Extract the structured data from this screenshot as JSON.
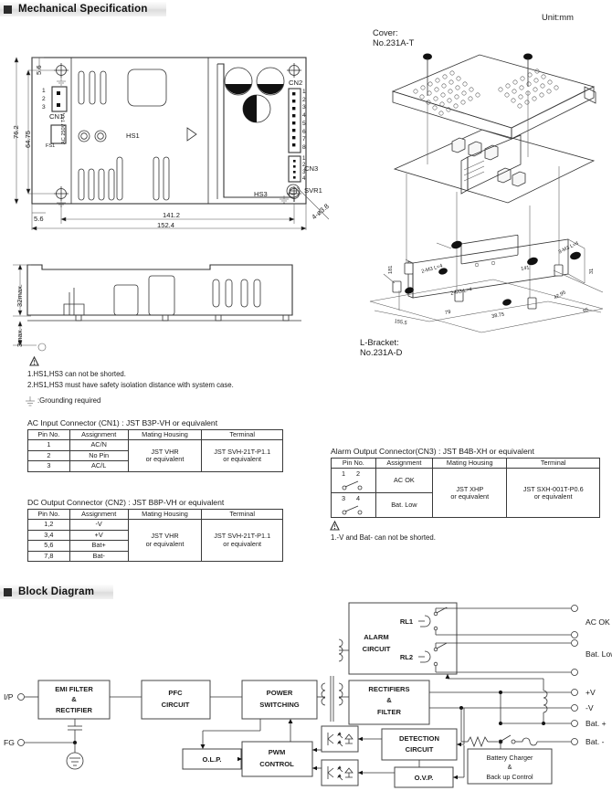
{
  "sections": {
    "mechanical": "Mechanical Specification",
    "block": "Block Diagram"
  },
  "mechanical": {
    "unit_note": "Unit:mm",
    "cover_label_1": "Cover:",
    "cover_label_2": "No.231A-T",
    "bracket_label_1": "L-Bracket:",
    "bracket_label_2": "No.231A-D",
    "top_view": {
      "dim_height_total": "76.2",
      "dim_height_hole": "64.75",
      "dim_top_offset": "5.6",
      "dim_left_offset": "5.6",
      "dim_width_hole": "141.2",
      "dim_width_total": "152.4",
      "hole_callout": "4-ø3.8",
      "labels": {
        "cn1": "CN1",
        "cn2": "CN2",
        "cn3": "CN3",
        "hs1": "HS1",
        "hs3": "HS3",
        "svr1": "SVR1",
        "fs1": "FS1",
        "fuse_rating": "AC 250V T4A",
        "cn1_pins": [
          "1",
          "2",
          "3"
        ],
        "cn2_pins": [
          "1",
          "2",
          "3",
          "4",
          "5",
          "6",
          "7",
          "8"
        ],
        "cn3_pins": [
          "1",
          "2",
          "3",
          "4"
        ]
      }
    },
    "side_view": {
      "dim_height": "32max.",
      "dim_foot": "3max."
    },
    "bracket_dims": {
      "d_total": "155.5",
      "d_mid": "79",
      "d_small": "38.75",
      "d_depth": "65",
      "d_depth2": "42.95",
      "d_side": "31",
      "d_141": "141",
      "d_181": "181",
      "screw_2m3": "2-M3 L=4",
      "screw_3m3": "3-M3 L=4"
    }
  },
  "warnings": {
    "note_1": "1.HS1,HS3 can not be shorted.",
    "note_2": "2.HS1,HS3 must have safety isolation distance with system case.",
    "note_ground": ":Grounding required",
    "note_bat": "1.-V and Bat- can not be shorted."
  },
  "tables": {
    "ac_input": {
      "caption": "AC Input Connector (CN1) : JST B3P-VH or equivalent",
      "headers": [
        "Pin No.",
        "Assignment",
        "Mating Housing",
        "Terminal"
      ],
      "rows": [
        {
          "pin": "1",
          "assignment": "AC/N"
        },
        {
          "pin": "2",
          "assignment": "No Pin"
        },
        {
          "pin": "3",
          "assignment": "AC/L"
        }
      ],
      "housing_1": "JST VHR",
      "housing_2": "or equivalent",
      "terminal_1": "JST SVH-21T-P1.1",
      "terminal_2": "or equivalent"
    },
    "dc_output": {
      "caption": "DC Output Connector (CN2) : JST B8P-VH or equivalent",
      "headers": [
        "Pin No.",
        "Assignment",
        "Mating Housing",
        "Terminal"
      ],
      "rows": [
        {
          "pin": "1,2",
          "assignment": "-V"
        },
        {
          "pin": "3,4",
          "assignment": "+V"
        },
        {
          "pin": "5,6",
          "assignment": "Bat+"
        },
        {
          "pin": "7,8",
          "assignment": "Bat-"
        }
      ],
      "housing_1": "JST VHR",
      "housing_2": "or equivalent",
      "terminal_1": "JST SVH-21T-P1.1",
      "terminal_2": "or equivalent"
    },
    "alarm_output": {
      "caption": "Alarm Output Connector(CN3) : JST B4B-XH or equivalent",
      "headers": [
        "Pin No.",
        "Assignment",
        "Mating Housing",
        "Terminal"
      ],
      "rows": [
        {
          "pin_a": "1",
          "pin_b": "2",
          "assignment": "AC OK"
        },
        {
          "pin_a": "3",
          "pin_b": "4",
          "assignment": "Bat. Low"
        }
      ],
      "housing_1": "JST XHP",
      "housing_2": "or equivalent",
      "terminal_1": "JST SXH-001T-P0.6",
      "terminal_2": "or equivalent"
    }
  },
  "block_diagram": {
    "inputs": [
      {
        "name": "I/P"
      },
      {
        "name": "FG"
      }
    ],
    "blocks": [
      {
        "id": "emi",
        "lines": [
          "EMI FILTER",
          "&",
          "RECTIFIER"
        ]
      },
      {
        "id": "pfc",
        "lines": [
          "PFC",
          "CIRCUIT"
        ]
      },
      {
        "id": "pwr",
        "lines": [
          "POWER",
          "SWITCHING"
        ]
      },
      {
        "id": "olp",
        "lines": [
          "O.L.P."
        ]
      },
      {
        "id": "pwm",
        "lines": [
          "PWM",
          "CONTROL"
        ]
      },
      {
        "id": "alarm",
        "lines": [
          "ALARM",
          "CIRCUIT"
        ]
      },
      {
        "id": "rect",
        "lines": [
          "RECTIFIERS",
          "&",
          "FILTER"
        ]
      },
      {
        "id": "detect",
        "lines": [
          "DETECTION",
          "CIRCUIT"
        ]
      },
      {
        "id": "ovp",
        "lines": [
          "O.V.P."
        ]
      },
      {
        "id": "charger",
        "lines": [
          "Battery Charger",
          "&",
          "Back up Control"
        ]
      }
    ],
    "relays": [
      "RL1",
      "RL2"
    ],
    "outputs": [
      {
        "name": "AC OK"
      },
      {
        "name": "Bat. Low"
      },
      {
        "name": "+V"
      },
      {
        "name": "-V"
      },
      {
        "name": "Bat. +"
      },
      {
        "name": "Bat. -"
      }
    ]
  }
}
